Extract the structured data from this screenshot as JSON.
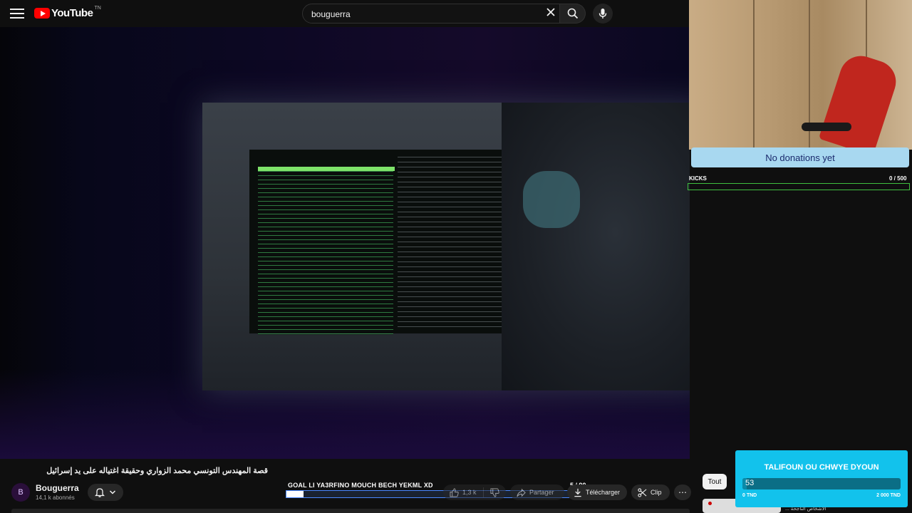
{
  "header": {
    "logo_text": "YouTube",
    "logo_region": "TN",
    "search_value": "bouguerra",
    "icons": [
      "menu-icon",
      "youtube-logo-icon",
      "close-icon",
      "search-icon",
      "microphone-icon"
    ]
  },
  "overlay": {
    "donation_text": "No donations yet",
    "kicks_label": "KICKS",
    "kicks_count": "0  / 500",
    "kicks_progress": 0.0
  },
  "video_info": {
    "title": "قصة المهندس التونسي محمد الزواري وحقيقة اغتياله على يد إسرائيل",
    "channel_name": "Bouguerra",
    "subscribers": "14,1 k abonnés",
    "avatar_letter": "B"
  },
  "goal_bar": {
    "title": "GOAL LI YA3RFINO MOUCH BECH YEKML XD",
    "count": "5  / 90",
    "progress": 0.055
  },
  "actions": {
    "like_count": "1,3 k",
    "share_label": "Partager",
    "download_label": "Télécharger",
    "clip_label": "Clip",
    "more_label": "⋯"
  },
  "sidebar": {
    "chip_all": "Tout",
    "reco_title": "الأشخاص الناجحة ..."
  },
  "widget": {
    "title": "TALIFOUN OU CHWYE DYOUN",
    "value": "53",
    "min_label": "0 TND",
    "max_label": "2 000 TND",
    "progress": 0.0265
  },
  "colors": {
    "youtube_red": "#ff0000",
    "widget_cyan": "#12c2ec",
    "kicks_green": "#3fbf3f",
    "donation_blue": "#a8d8f0",
    "goal_border": "#4a88ff"
  }
}
